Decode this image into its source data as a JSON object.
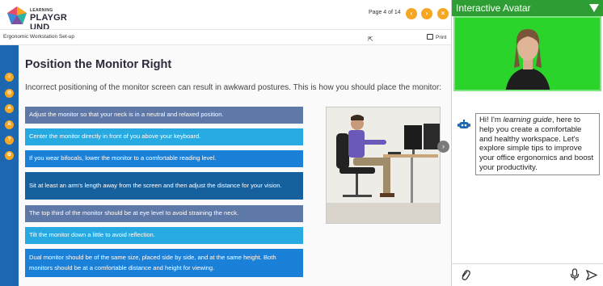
{
  "header": {
    "logo_small": "LEARNING",
    "logo_big": "PLAYGR  UND",
    "page_indicator": "Page 4 of 14",
    "prev_icon": "chevron-left-icon",
    "next_icon": "chevron-right-icon",
    "close_icon": "close-icon",
    "breadcrumb": "Ergonomic Workstation Set-up",
    "print_label": "Print"
  },
  "sidebar": {
    "icons": [
      "menu-icon",
      "resources-icon",
      "glossary-icon",
      "text-size-icon",
      "help-icon",
      "settings-icon"
    ]
  },
  "main": {
    "title": "Position the Monitor Right",
    "intro": "Incorrect positioning of the monitor screen can result in awkward postures. This is how you should place the monitor:",
    "items": [
      {
        "text": "Adjust the monitor so that your neck is in a neutral and relaxed position.",
        "color": "#5e78a8"
      },
      {
        "text": "Center the monitor directly in front of you above your keyboard.",
        "color": "#27a9e1"
      },
      {
        "text": "If you wear bifocals, lower the monitor to a comfortable reading level.",
        "color": "#1a80d8"
      },
      {
        "text": "Sit at least an arm's length away from the screen and then adjust the distance for your vision.",
        "color": "#17609e"
      },
      {
        "text": "The top third of the monitor should be at eye level to avoid straining the neck.",
        "color": "#5e78a8"
      },
      {
        "text": "Tilt the monitor down a little to avoid reflection.",
        "color": "#27a9e1"
      },
      {
        "text": "Dual monitor should be of the same size, placed side by side, and at the same height. Both monitors should be at a comfortable distance and height for viewing.",
        "color": "#1a80d8"
      }
    ]
  },
  "panel": {
    "title": "Interactive Avatar",
    "message_pre": "Hi! I'm ",
    "message_em": "learning guide",
    "message_post": ", here to help you create a comfortable and healthy workspace. Let's explore simple tips to improve your office ergonomics and boost your productivity."
  },
  "colors": {
    "accent_orange": "#f5a623",
    "sidebar_blue": "#1d67b1",
    "panel_green": "#2e9e34",
    "avatar_green": "#2bd42b"
  }
}
